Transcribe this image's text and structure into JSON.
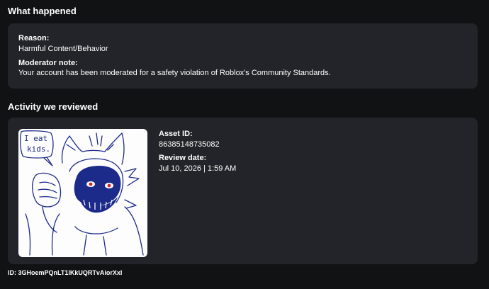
{
  "what_happened": {
    "title": "What happened",
    "reason_label": "Reason:",
    "reason_value": "Harmful Content/Behavior",
    "note_label": "Moderator note:",
    "note_value": "Your account has been moderated for a safety violation of Roblox's Community Standards."
  },
  "activity": {
    "title": "Activity we reviewed",
    "asset_image_caption": "I eat kids.",
    "asset_id_label": "Asset ID:",
    "asset_id_value": "86385148735082",
    "review_date_label": "Review date:",
    "review_date_value": "Jul 10, 2026 | 1:59 AM"
  },
  "footer": {
    "id_text": "ID: 3GHoemPQnLT1lKkUQRTvAiorXxI"
  },
  "colors": {
    "background": "#111214",
    "card": "#232429",
    "sketch_ink": "#1c2a8a",
    "eye_red": "#d8202a"
  }
}
